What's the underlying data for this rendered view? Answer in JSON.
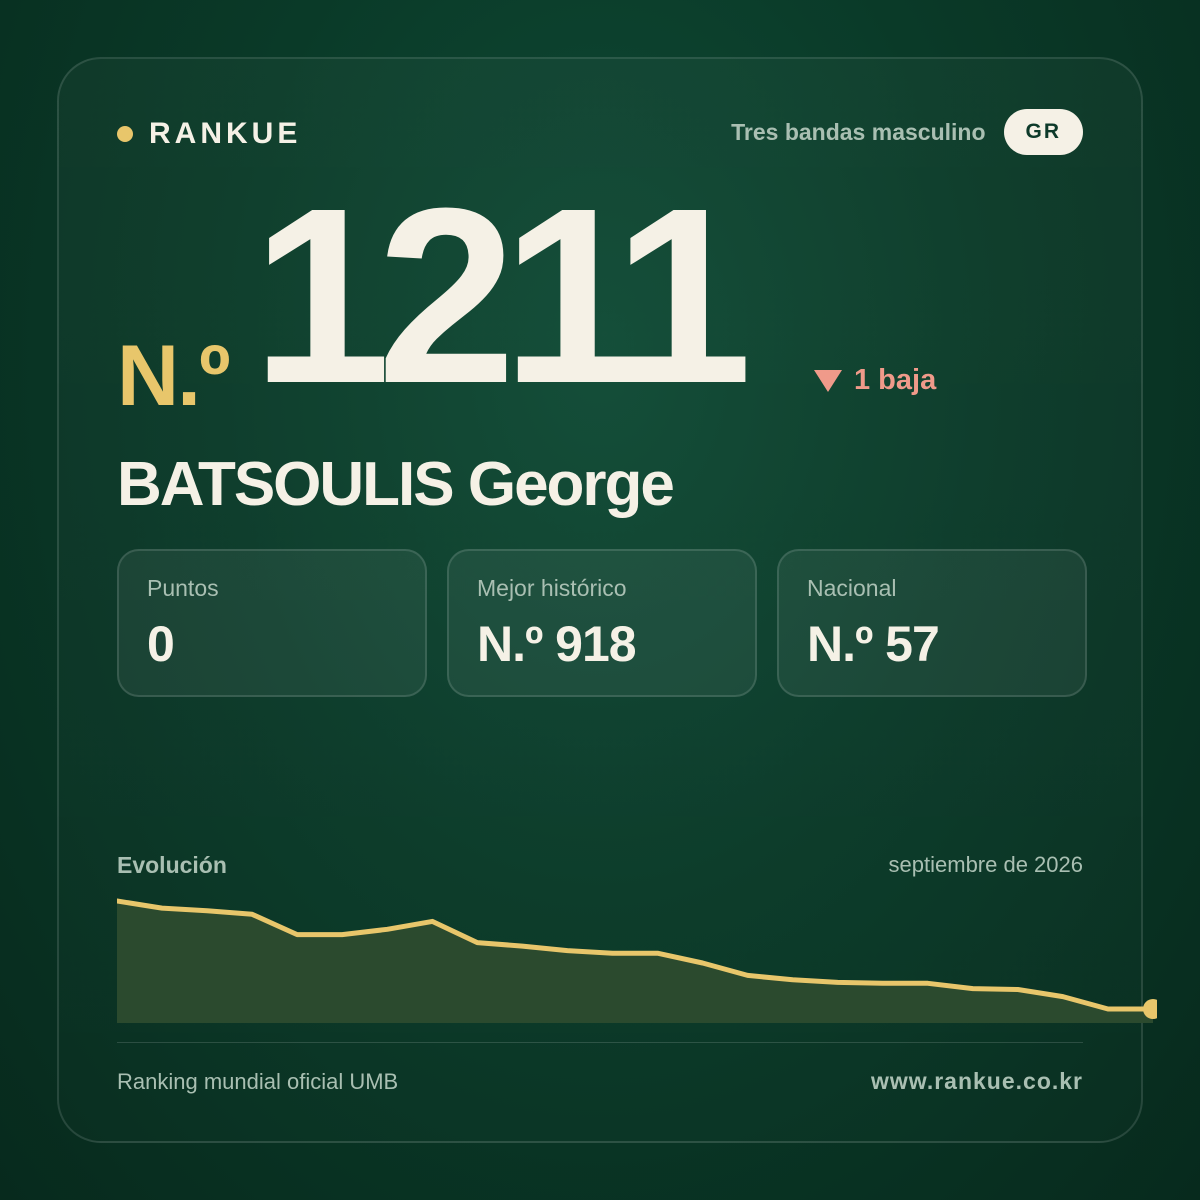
{
  "brand": {
    "name": "RANKUE",
    "dot_color": "#e8c66b"
  },
  "header": {
    "category": "Tres bandas masculino",
    "country": "GR"
  },
  "rank": {
    "prefix": "N.º",
    "number": "1211",
    "change_icon": "down-triangle-icon",
    "change_text": "1 baja",
    "change_color": "#f09a8a"
  },
  "player": {
    "name": "BATSOULIS George"
  },
  "stats": [
    {
      "label": "Puntos",
      "value": "0"
    },
    {
      "label": "Mejor histórico",
      "value": "N.º 918"
    },
    {
      "label": "Nacional",
      "value": "N.º 57"
    }
  ],
  "evolution": {
    "label": "Evolución",
    "date": "septiembre de 2026",
    "line_color": "#e8c66b",
    "values": [
      1080,
      1088,
      1091,
      1095,
      1118,
      1118,
      1112,
      1103,
      1127,
      1131,
      1136,
      1139,
      1139,
      1150,
      1164,
      1169,
      1172,
      1173,
      1173,
      1179,
      1180,
      1188,
      1202,
      1202
    ]
  },
  "footer": {
    "left": "Ranking mundial oficial UMB",
    "right": "www.rankue.co.kr"
  }
}
